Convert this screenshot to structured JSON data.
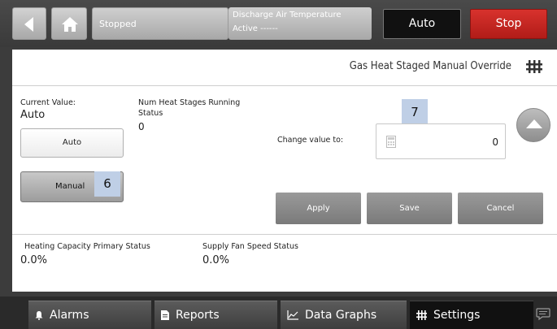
{
  "topbar": {
    "status": "Stopped",
    "info_title": "Discharge Air Temperature",
    "info_value": "Active ------",
    "auto_label": "Auto",
    "stop_label": "Stop"
  },
  "panel": {
    "title": "Gas Heat Staged Manual Override",
    "current_value_label": "Current Value:",
    "current_value": "Auto",
    "num_heat_label_1": "Num Heat Stages Running",
    "num_heat_label_2": "Status",
    "num_heat_value": "0",
    "auto_button": "Auto",
    "manual_button": "Manual",
    "badge_6": "6",
    "badge_7": "7",
    "change_value_label": "Change value to:",
    "input_value": "0",
    "apply_label": "Apply",
    "save_label": "Save",
    "cancel_label": "Cancel",
    "heating_capacity_label": "Heating Capacity Primary Status",
    "heating_capacity_value": "0.0%",
    "supply_fan_label": "Supply Fan Speed Status",
    "supply_fan_value": "0.0%"
  },
  "nav": {
    "alarms": "Alarms",
    "reports": "Reports",
    "data_graphs": "Data Graphs",
    "settings": "Settings"
  },
  "colors": {
    "stop_red": "#c8221e",
    "badge_blue": "#bfcfe6"
  }
}
